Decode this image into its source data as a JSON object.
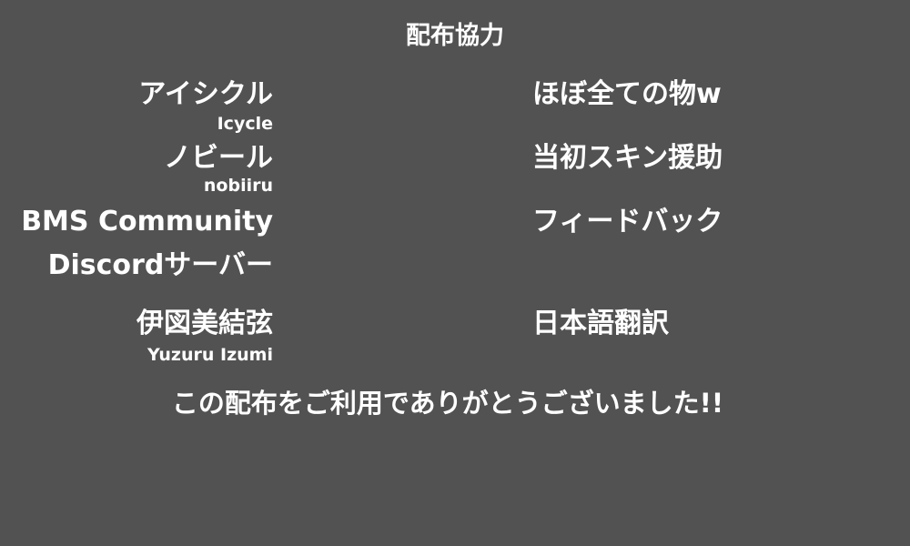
{
  "title": "配布協力",
  "credits": [
    {
      "name": "アイシクル",
      "romaji": "Icycle",
      "role": "ほぼ全ての物w"
    },
    {
      "name": "ノビール",
      "romaji": "nobiiru",
      "role": "当初スキン援助"
    },
    {
      "name_line1": "BMS Community",
      "name_line2": "Discordサーバー",
      "role": "フィードバック"
    },
    {
      "name": "伊図美結弦",
      "romaji": "Yuzuru Izumi",
      "role": "日本語翻訳"
    }
  ],
  "footer": "この配布をご利用でありがとうございました!!"
}
